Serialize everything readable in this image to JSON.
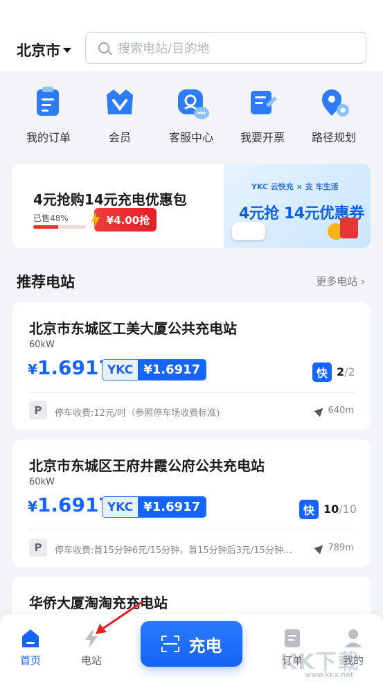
{
  "header": {
    "city": "北京市",
    "search_placeholder": "搜索电站/目的地"
  },
  "quick_menu": [
    {
      "label": "我的订单",
      "icon": "order-icon"
    },
    {
      "label": "会员",
      "icon": "vip-icon"
    },
    {
      "label": "客服中心",
      "icon": "customer-service-icon"
    },
    {
      "label": "我要开票",
      "icon": "invoice-icon"
    },
    {
      "label": "路径规划",
      "icon": "route-icon"
    }
  ],
  "promo": {
    "title": "4元抢购14元充电优惠包",
    "sold": "已售48%",
    "sold_fraction": 0.48,
    "button": "¥4.00抢",
    "banner_brand": "YKC 云快充 × 支 车生活",
    "banner_text": "4元抢 14元优惠券"
  },
  "section": {
    "title": "推荐电站",
    "more": "更多电站"
  },
  "stations": [
    {
      "name": "北京市东城区工美大厦公共充电站",
      "power": "60kW",
      "price_symbol": "¥",
      "price": "1.6917",
      "ykc_tag": "YKC",
      "ykc_price": "¥1.6917",
      "fast_label": "快",
      "available": "2",
      "total": "/2",
      "parking_label": "P",
      "parking": "停车收费:12元/时（参照停车场收费标准)",
      "distance": "640m"
    },
    {
      "name": "北京市东城区王府井霞公府公共充电站",
      "power": "60kW",
      "price_symbol": "¥",
      "price": "1.6917",
      "ykc_tag": "YKC",
      "ykc_price": "¥1.6917",
      "fast_label": "快",
      "available": "10",
      "total": "/10",
      "parking_label": "P",
      "parking": "停车收费:首15分钟6元/15分钟，首15分钟后3元/15分钟…",
      "distance": "789m"
    },
    {
      "name": "华侨大厦淘淘充充电站"
    }
  ],
  "tabbar": {
    "home": "首页",
    "stations": "电站",
    "charge": "充电",
    "orders": "订单",
    "mine": "我的"
  },
  "watermark": {
    "text": "KK下载",
    "url": "www.kkx.net"
  },
  "colors": {
    "primary": "#1664ff",
    "promo_red": "#e8332f"
  }
}
